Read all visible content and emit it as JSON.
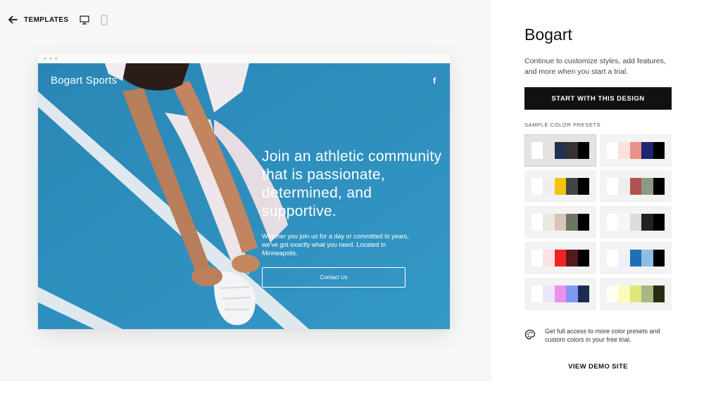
{
  "toolbar": {
    "back_icon": "arrow-left-icon",
    "templates_label": "TEMPLATES",
    "desktop_icon": "desktop-icon",
    "mobile_icon": "mobile-icon"
  },
  "preview": {
    "site_title": "Bogart Sports",
    "social_icon": "facebook-icon",
    "social_glyph": "f",
    "heading": "Join an athletic community that is passionate, determined, and supportive.",
    "subtext": "Whether you join us for a day or committed to years, we've got exactly what you need. Located in Minneapolis.",
    "cta_label": "Contact Us"
  },
  "panel": {
    "template_name": "Bogart",
    "description": "Continue to customize styles, add features, and more when you start a trial.",
    "start_button": "START WITH THIS DESIGN",
    "presets_label": "SAMPLE COLOR PRESETS",
    "presets": [
      {
        "selected": true,
        "colors": [
          "#ffffff",
          "#e2e2e2",
          "#233150",
          "#333333",
          "#000000"
        ]
      },
      {
        "selected": false,
        "colors": [
          "#ffffff",
          "#fbe1d6",
          "#ec8f86",
          "#1a2670",
          "#000000"
        ]
      },
      {
        "selected": false,
        "colors": [
          "#ffffff",
          "#efefef",
          "#f4c40f",
          "#444444",
          "#000000"
        ]
      },
      {
        "selected": false,
        "colors": [
          "#ffffff",
          "#eeeeee",
          "#b05151",
          "#8b9a87",
          "#000000"
        ]
      },
      {
        "selected": false,
        "colors": [
          "#ffffff",
          "#ebe7e1",
          "#d9c5b5",
          "#6c7462",
          "#000000"
        ]
      },
      {
        "selected": false,
        "colors": [
          "#ffffff",
          "#f6f6f6",
          "#dcdcdc",
          "#222222",
          "#000000"
        ]
      },
      {
        "selected": false,
        "colors": [
          "#ffffff",
          "#fde2e2",
          "#ee2222",
          "#551a1a",
          "#000000"
        ]
      },
      {
        "selected": false,
        "colors": [
          "#ffffff",
          "#eaf1fb",
          "#1f6fb6",
          "#8dbce6",
          "#000000"
        ]
      },
      {
        "selected": false,
        "colors": [
          "#ffffff",
          "#e9e6fb",
          "#ec8fed",
          "#8097f2",
          "#1d2b52"
        ]
      },
      {
        "selected": false,
        "colors": [
          "#fffff2",
          "#fbfbbd",
          "#dde87a",
          "#a9b783",
          "#282d12"
        ]
      }
    ],
    "promo_icon": "palette-icon",
    "promo_text": "Get full access to more color presets and custom colors in your free trial.",
    "demo_link": "VIEW DEMO SITE"
  }
}
